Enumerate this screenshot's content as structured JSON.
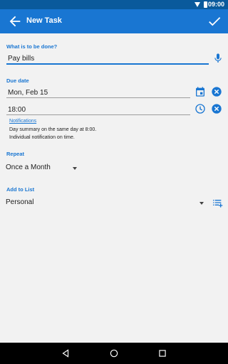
{
  "status_bar": {
    "time": "09:00"
  },
  "app_bar": {
    "title": "New Task",
    "back_icon": "arrow-back-icon",
    "save_icon": "check-icon"
  },
  "task": {
    "label": "What is to be done?",
    "value": "Pay bills",
    "mic_icon": "mic-icon"
  },
  "due": {
    "label": "Due date",
    "date_value": "Mon, Feb 15",
    "time_value": "18:00",
    "calendar_icon": "calendar-icon",
    "clock_icon": "clock-icon",
    "clear_icon": "clear-circle-icon"
  },
  "notifications": {
    "link": "Notifications",
    "line1": "Day summary on the same day at 8:00.",
    "line2": "Individual notification on time."
  },
  "repeat": {
    "label": "Repeat",
    "value": "Once a Month"
  },
  "list": {
    "label": "Add to List",
    "value": "Personal",
    "list_icon": "list-add-icon"
  },
  "colors": {
    "primary": "#1976d2",
    "status_bar": "#0a5a9c",
    "background": "#f2f2f2"
  }
}
